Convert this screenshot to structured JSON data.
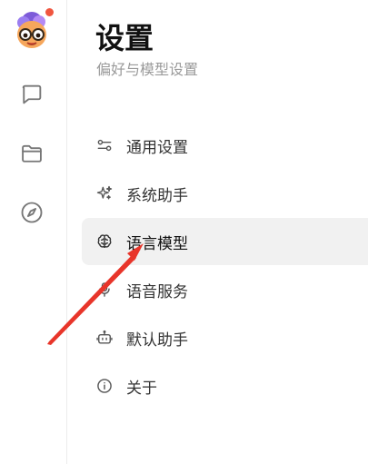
{
  "colors": {
    "accent_dot": "#f0553f",
    "icon_gray": "#666666",
    "active_bg": "#f1f1f1",
    "arrow": "#e8352a"
  },
  "rail": {
    "items": [
      {
        "icon": "chat-bubble-icon"
      },
      {
        "icon": "folder-icon"
      },
      {
        "icon": "compass-icon"
      }
    ]
  },
  "settings": {
    "title": "设置",
    "subtitle": "偏好与模型设置",
    "menu": [
      {
        "label": "通用设置",
        "icon": "sliders-icon",
        "active": false
      },
      {
        "label": "系统助手",
        "icon": "sparkles-icon",
        "active": false
      },
      {
        "label": "语言模型",
        "icon": "brain-icon",
        "active": true
      },
      {
        "label": "语音服务",
        "icon": "microphone-icon",
        "active": false
      },
      {
        "label": "默认助手",
        "icon": "bot-icon",
        "active": false
      },
      {
        "label": "关于",
        "icon": "info-icon",
        "active": false
      }
    ]
  }
}
